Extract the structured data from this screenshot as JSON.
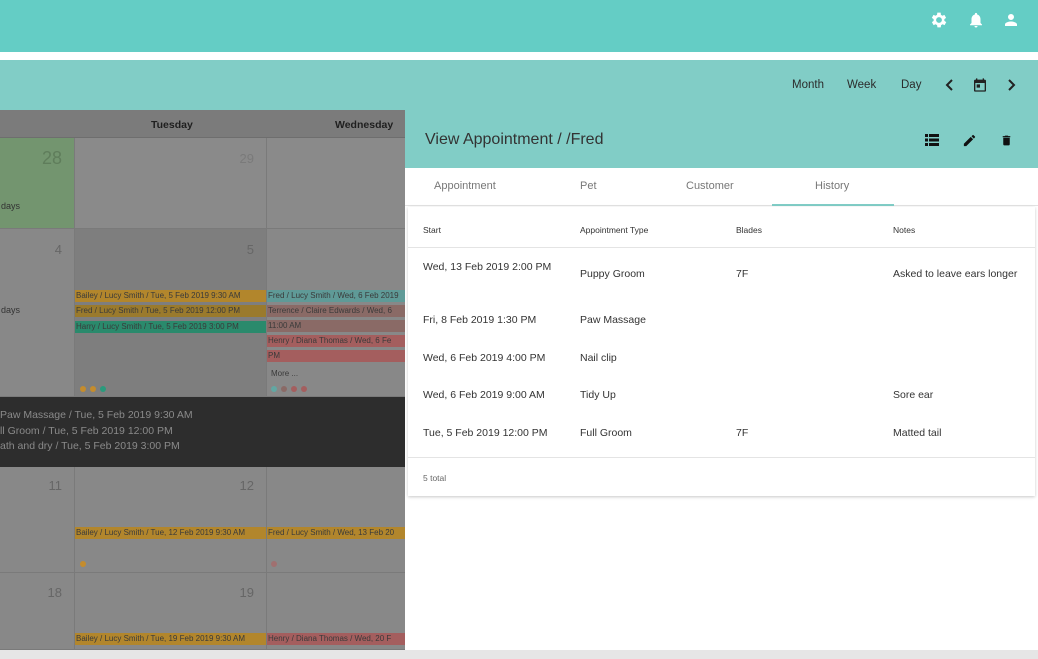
{
  "appbar": {
    "icons": [
      "gear-icon",
      "bell-icon",
      "account-icon"
    ]
  },
  "toolbar": {
    "month": "Month",
    "week": "Week",
    "day": "Day",
    "icons": [
      "chevron-left-icon",
      "calendar-today-icon",
      "chevron-right-icon"
    ]
  },
  "calendar": {
    "headers": {
      "tuesday": "Tuesday",
      "wednesday": "Wednesday"
    },
    "days": {
      "d28": "28",
      "d29": "29",
      "d4": "4",
      "d5": "5",
      "d11": "11",
      "d12": "12",
      "d18": "18",
      "d19": "19"
    },
    "days_label_1": "days",
    "days_label_2": "days",
    "events": {
      "tue5_1": "Bailey / Lucy Smith / Tue, 5 Feb 2019 9:30 AM",
      "tue5_2": "Fred / Lucy Smith / Tue, 5 Feb 2019 12:00 PM",
      "tue5_3": "Harry / Lucy Smith / Tue, 5 Feb 2019 3:00 PM",
      "wed6_1": "Fred / Lucy Smith / Wed, 6 Feb 2019",
      "wed6_2": "Terrence / Claire Edwards / Wed, 6",
      "wed6_2b": "11:00 AM",
      "wed6_3": "Henry / Diana Thomas / Wed, 6 Fe",
      "wed6_3b": "PM",
      "more": "More ...",
      "tue12": "Bailey / Lucy Smith / Tue, 12 Feb 2019 9:30 AM",
      "wed13": "Fred / Lucy Smith / Wed, 13 Feb 20",
      "tue19": "Bailey / Lucy Smith / Tue, 19 Feb 2019 9:30 AM",
      "wed20": "Henry / Diana Thomas / Wed, 20 F"
    },
    "popup": [
      "Paw Massage / Tue, 5 Feb 2019 9:30 AM",
      "ll Groom / Tue, 5 Feb 2019 12:00 PM",
      "ath and dry / Tue, 5 Feb 2019 3:00 PM"
    ],
    "colors": {
      "orange": "#c48c2d",
      "green": "#2a9a7c",
      "teal": "#62a7a3",
      "red": "#c06a6a",
      "grey": "#8a8a8a"
    }
  },
  "dialog": {
    "title": "View Appointment / /Fred",
    "actions": [
      "list-icon",
      "edit-icon",
      "delete-icon"
    ],
    "tabs": [
      "Appointment",
      "Pet",
      "Customer",
      "History"
    ],
    "active_tab": "History",
    "table": {
      "headers": [
        "Start",
        "Appointment Type",
        "Blades",
        "Notes"
      ],
      "rows": [
        {
          "start": "Wed, 13 Feb 2019 2:00 PM",
          "type": "Puppy Groom",
          "blades": "7F",
          "notes": "Asked to leave ears longer"
        },
        {
          "start": "Fri, 8 Feb 2019 1:30 PM",
          "type": "Paw Massage",
          "blades": "",
          "notes": ""
        },
        {
          "start": "Wed, 6 Feb 2019 4:00 PM",
          "type": "Nail clip",
          "blades": "",
          "notes": ""
        },
        {
          "start": "Wed, 6 Feb 2019 9:00 AM",
          "type": "Tidy Up",
          "blades": "",
          "notes": "Sore ear"
        },
        {
          "start": "Tue, 5 Feb 2019 12:00 PM",
          "type": "Full Groom",
          "blades": "7F",
          "notes": "Matted tail"
        }
      ],
      "total": "5 total"
    }
  }
}
